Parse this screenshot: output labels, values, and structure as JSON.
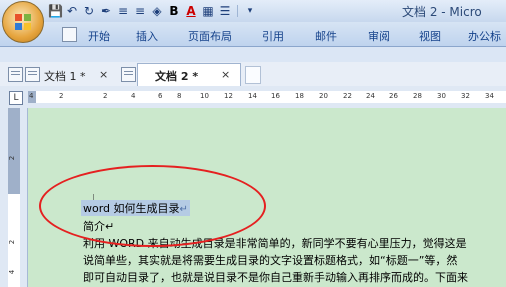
{
  "window": {
    "title": "文档 2 - Micro"
  },
  "quick_access": {
    "icons": [
      "save-icon",
      "undo-icon",
      "redo-icon",
      "format-painter-icon",
      "bullets-icon",
      "numbering-icon",
      "shading-icon",
      "bold-icon",
      "font-color-icon",
      "borders-icon",
      "align-icon",
      "customize-icon"
    ],
    "bold_glyph": "B",
    "font_color_glyph": "A"
  },
  "ribbon": {
    "tabs": [
      "开始",
      "插入",
      "页面布局",
      "引用",
      "邮件",
      "审阅",
      "视图",
      "办公标"
    ]
  },
  "doc_tabs": [
    {
      "label": "文档 1 *",
      "close": "×",
      "active": false
    },
    {
      "label": "文档 2 *",
      "close": "×",
      "active": true
    }
  ],
  "ruler": {
    "selector_glyph": "L",
    "numbers": [
      "4",
      "2",
      "2",
      "4",
      "6",
      "8",
      "10",
      "12",
      "14",
      "16",
      "18",
      "20",
      "22",
      "24",
      "26",
      "28",
      "30",
      "32",
      "34"
    ],
    "v_numbers": [
      "2",
      "2",
      "4"
    ]
  },
  "document": {
    "heading": "word 如何生成目录",
    "paragraph_mark": "↵",
    "lines": [
      "简介↵",
      "利用 WORD 来自动生成目录是非常简单的，新同学不要有心里压力，觉得这是",
      "说简单些，其实就是将需要生成目录的文字设置标题格式，如“标题一”等，然",
      "即可自动目录了，也就是说目录不是你自己重新手动输入再排序而成的。下面来"
    ]
  },
  "colors": {
    "page_background": "#cbe8cc",
    "annotation_circle": "#e52020",
    "ribbon_text": "#15428b"
  }
}
